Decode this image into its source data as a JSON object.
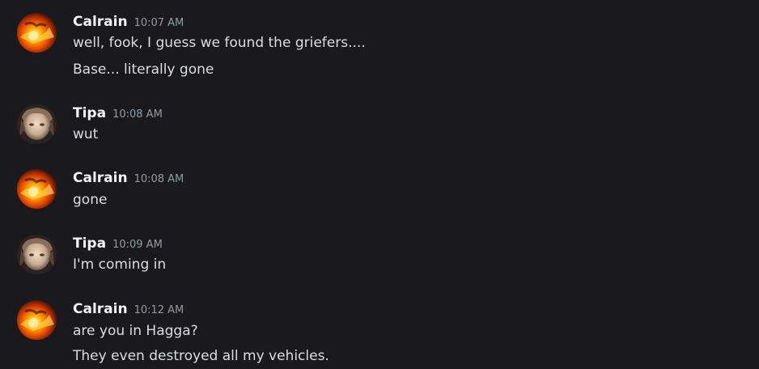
{
  "messages": [
    {
      "author": "Calrain",
      "time": "10:07 AM",
      "avatar": "fire-avatar",
      "lines": [
        "well, fook, I guess we found the griefers....",
        "Base... literally gone"
      ]
    },
    {
      "author": "Tipa",
      "time": "10:08 AM",
      "avatar": "portrait-avatar",
      "lines": [
        "wut"
      ]
    },
    {
      "author": "Calrain",
      "time": "10:08 AM",
      "avatar": "fire-avatar",
      "lines": [
        "gone"
      ]
    },
    {
      "author": "Tipa",
      "time": "10:09 AM",
      "avatar": "portrait-avatar",
      "lines": [
        "I'm coming in"
      ]
    },
    {
      "author": "Calrain",
      "time": "10:12 AM",
      "avatar": "fire-avatar",
      "lines": [
        "are you in Hagga?",
        "They even destroyed all my vehicles."
      ]
    }
  ],
  "colors": {
    "background": "#1a1a1e",
    "username": "#f2f3f5",
    "timestamp": "#949ba4",
    "message_text": "#dbdee1"
  }
}
